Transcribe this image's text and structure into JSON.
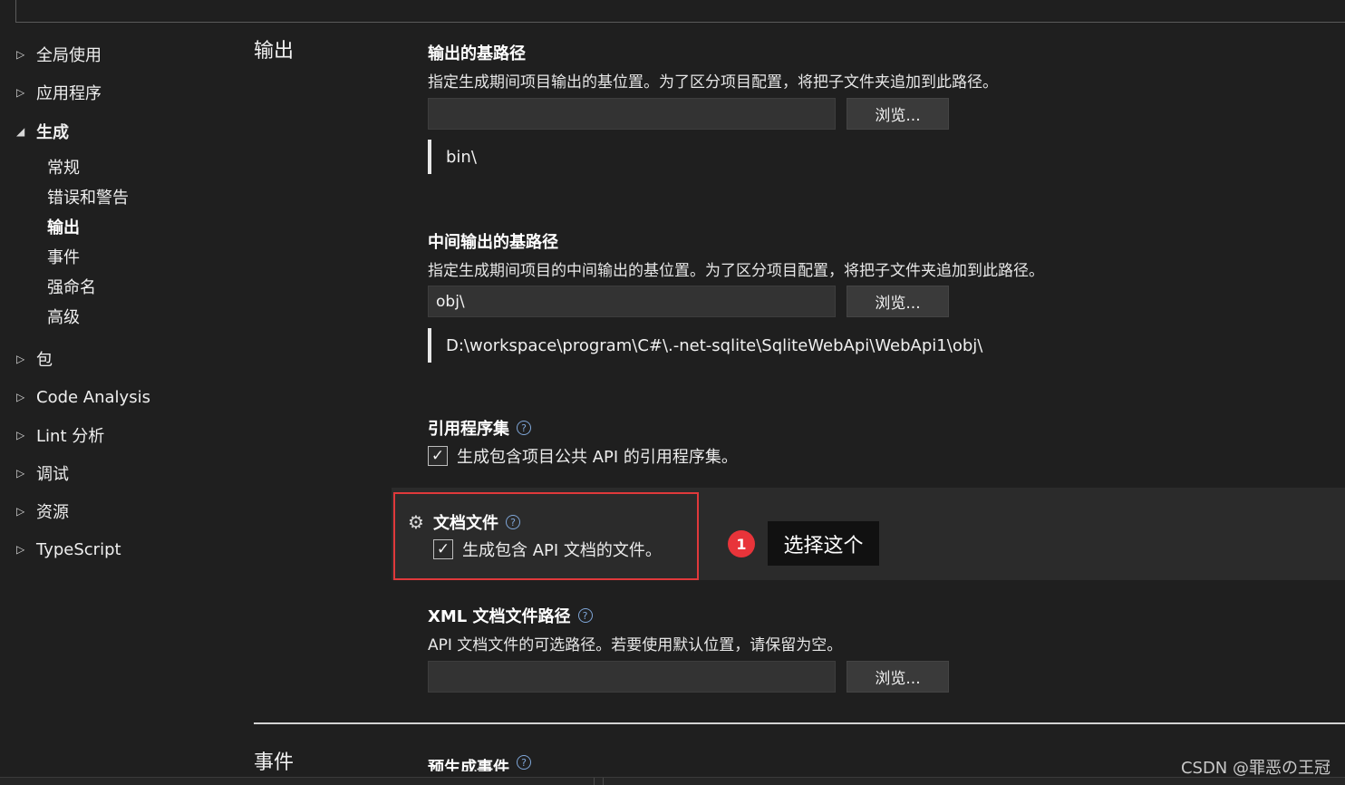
{
  "sidebar": {
    "items": [
      {
        "label": "全局使用",
        "expanded": false
      },
      {
        "label": "应用程序",
        "expanded": false
      },
      {
        "label": "生成",
        "expanded": true,
        "children": [
          "常规",
          "错误和警告",
          "输出",
          "事件",
          "强命名",
          "高级"
        ],
        "active_child": "输出"
      },
      {
        "label": "包",
        "expanded": false
      },
      {
        "label": "Code Analysis",
        "expanded": false
      },
      {
        "label": "Lint 分析",
        "expanded": false
      },
      {
        "label": "调试",
        "expanded": false
      },
      {
        "label": "资源",
        "expanded": false
      },
      {
        "label": "TypeScript",
        "expanded": false
      }
    ]
  },
  "main": {
    "section_title": "输出",
    "next_section_title": "事件",
    "base_output": {
      "title": "输出的基路径",
      "description": "指定生成期间项目输出的基位置。为了区分项目配置，将把子文件夹追加到此路径。",
      "value": "",
      "browse_label": "浏览...",
      "evaluated": "bin\\"
    },
    "intermediate_output": {
      "title": "中间输出的基路径",
      "description": "指定生成期间项目的中间输出的基位置。为了区分项目配置，将把子文件夹追加到此路径。",
      "value": "obj\\",
      "browse_label": "浏览...",
      "evaluated": "D:\\workspace\\program\\C#\\.-net-sqlite\\SqliteWebApi\\WebApi1\\obj\\"
    },
    "reference_assembly": {
      "title": "引用程序集",
      "checkbox_label": "生成包含项目公共 API 的引用程序集。",
      "checked": true
    },
    "documentation_file": {
      "title": "文档文件",
      "checkbox_label": "生成包含 API 文档的文件。",
      "checked": true
    },
    "xml_doc_path": {
      "title": "XML 文档文件路径",
      "description": "API 文档文件的可选路径。若要使用默认位置，请保留为空。",
      "value": "",
      "browse_label": "浏览..."
    },
    "prebuild_event": {
      "title": "预生成事件"
    }
  },
  "annotation": {
    "badge": "1",
    "tooltip": "选择这个",
    "frame_color": "#e0393b"
  },
  "watermark": "CSDN @罪恶の王冠",
  "icons": {
    "collapsed": "caret-right-icon",
    "expanded": "caret-down-icon",
    "help": "help-circle-icon",
    "gear": "gear-icon",
    "check": "check-icon"
  }
}
